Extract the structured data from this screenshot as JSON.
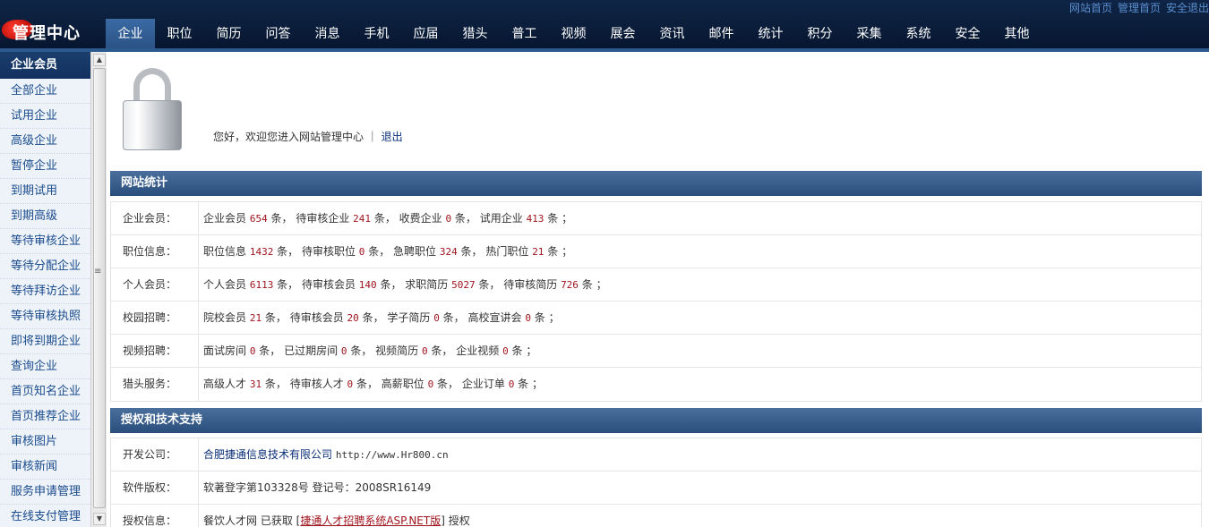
{
  "header": {
    "logo_text": "管理中心",
    "top_links": [
      "网站首页",
      "管理首页",
      "安全退出"
    ],
    "nav": [
      "企业",
      "职位",
      "简历",
      "问答",
      "消息",
      "手机",
      "应届",
      "猎头",
      "普工",
      "视频",
      "展会",
      "资讯",
      "邮件",
      "统计",
      "积分",
      "采集",
      "系统",
      "安全",
      "其他"
    ],
    "active_nav": "企业"
  },
  "sidebar": {
    "title": "企业会员",
    "items": [
      "全部企业",
      "试用企业",
      "高级企业",
      "暂停企业",
      "到期试用",
      "到期高级",
      "等待审核企业",
      "等待分配企业",
      "等待拜访企业",
      "等待审核执照",
      "即将到期企业",
      "查询企业",
      "首页知名企业",
      "首页推荐企业",
      "审核图片",
      "审核新闻",
      "服务申请管理",
      "在线支付管理"
    ]
  },
  "welcome": {
    "text": "您好，欢迎您进入网站管理中心 ｜",
    "logout": "退出"
  },
  "stats": {
    "title": "网站统计",
    "rows": [
      {
        "label": "企业会员：",
        "parts": [
          "企业会员 ",
          "654",
          " 条， 待审核企业 ",
          "241",
          " 条， 收费企业 ",
          "0",
          " 条， 试用企业 ",
          "413",
          " 条 ；"
        ]
      },
      {
        "label": "职位信息：",
        "parts": [
          "职位信息 ",
          "1432",
          " 条， 待审核职位 ",
          "0",
          " 条， 急聘职位 ",
          "324",
          " 条， 热门职位 ",
          "21",
          " 条 ；"
        ]
      },
      {
        "label": "个人会员：",
        "parts": [
          "个人会员 ",
          "6113",
          " 条， 待审核会员 ",
          "140",
          " 条， 求职简历 ",
          "5027",
          " 条， 待审核简历 ",
          "726",
          " 条 ；"
        ]
      },
      {
        "label": "校园招聘：",
        "parts": [
          "院校会员 ",
          "21",
          " 条， 待审核会员 ",
          "20",
          " 条， 学子简历 ",
          "0",
          " 条， 高校宣讲会 ",
          "0",
          " 条 ；"
        ]
      },
      {
        "label": "视频招聘：",
        "parts": [
          "面试房间 ",
          "0",
          " 条， 已过期房间 ",
          "0",
          " 条， 视频简历 ",
          "0",
          " 条， 企业视频 ",
          "0",
          " 条 ；"
        ]
      },
      {
        "label": "猎头服务：",
        "parts": [
          "高级人才 ",
          "31",
          " 条， 待审核人才 ",
          "0",
          " 条， 高薪职位 ",
          "0",
          " 条， 企业订单 ",
          "0",
          " 条 ；"
        ]
      }
    ]
  },
  "support": {
    "title": "授权和技术支持",
    "company_label": "开发公司：",
    "company_name": "合肥捷通信息技术有限公司",
    "company_url": "http://www.Hr800.cn",
    "copyright_label": "软件版权：",
    "copyright_value": "软著登字第103328号 登记号：2008SR16149",
    "license_label": "授权信息：",
    "license_prefix": "餐饮人才网 已获取 [",
    "license_product": "捷通人才招聘系统ASP.NET版",
    "license_suffix": "] 授权"
  }
}
